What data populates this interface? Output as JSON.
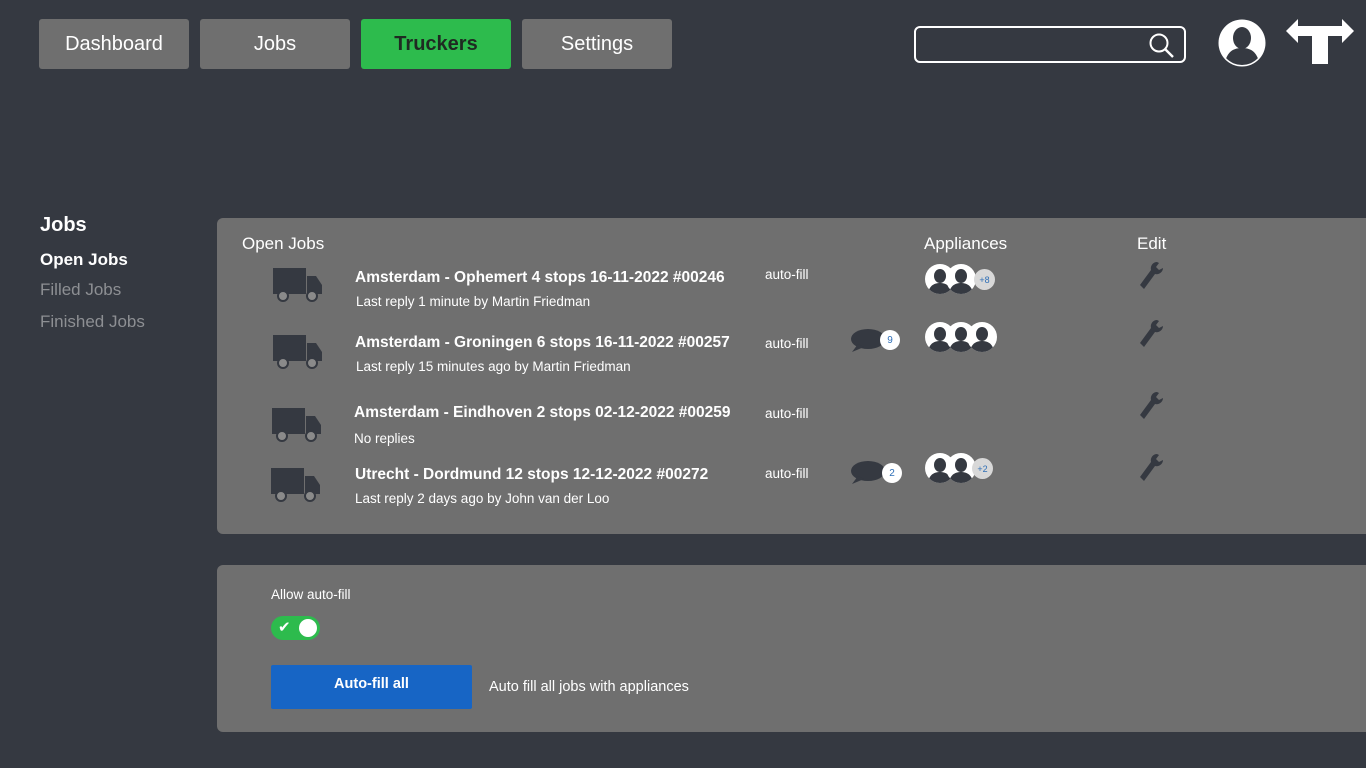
{
  "nav": {
    "tabs": [
      {
        "label": "Dashboard"
      },
      {
        "label": "Jobs"
      },
      {
        "label": "Truckers"
      },
      {
        "label": "Settings"
      }
    ],
    "active_tab": "Truckers",
    "search": {
      "value": "",
      "placeholder": ""
    }
  },
  "sidebar": {
    "title": "Jobs",
    "items": [
      {
        "label": "Open Jobs",
        "active": true
      },
      {
        "label": "Filled Jobs",
        "active": false
      },
      {
        "label": "Finished Jobs",
        "active": false
      }
    ]
  },
  "jobs_panel": {
    "heading": "Open Jobs",
    "col_appliances": "Appliances",
    "col_edit": "Edit",
    "jobs": [
      {
        "title": "Amsterdam - Ophemert 4 stops 16-11-2022 #00246",
        "sub": "Last reply 1 minute by Martin Friedman",
        "autofill": "auto-fill",
        "messages": null,
        "appliance_faces": 2,
        "appliance_more": "+8"
      },
      {
        "title": "Amsterdam - Groningen 6 stops 16-11-2022 #00257",
        "sub": "Last reply 15 minutes ago by Martin Friedman",
        "autofill": "auto-fill",
        "messages": "9",
        "appliance_faces": 3,
        "appliance_more": null
      },
      {
        "title": "Amsterdam - Eindhoven 2 stops 02-12-2022 #00259",
        "sub": "No replies",
        "autofill": "auto-fill",
        "messages": null,
        "appliance_faces": 0,
        "appliance_more": null
      },
      {
        "title": "Utrecht - Dordmund 12 stops 12-12-2022 #00272",
        "sub": "Last reply 2 days ago by John van der Loo",
        "autofill": "auto-fill",
        "messages": "2",
        "appliance_faces": 2,
        "appliance_more": "+2"
      }
    ]
  },
  "autofill_panel": {
    "allow_label": "Allow auto-fill",
    "toggle_on": true,
    "toggle_check": "✔",
    "button_label": "Auto-fill all",
    "description": "Auto fill all jobs with appliances"
  },
  "colors": {
    "background": "#353941",
    "panel": "#6f6f6f",
    "active_tab": "#2dbb4d",
    "primary_button": "#1765c5",
    "toggle": "#2dbb4d"
  }
}
